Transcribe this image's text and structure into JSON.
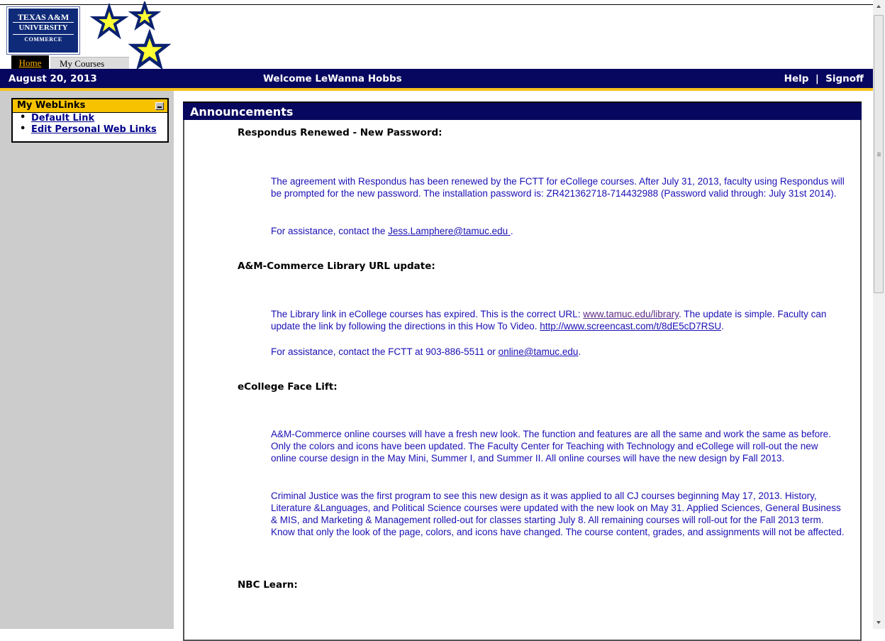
{
  "header": {
    "logo": {
      "line1": "TEXAS A&M",
      "line2": "UNIVERSITY",
      "line3": "COMMERCE"
    },
    "tabs": [
      {
        "label": "Home"
      },
      {
        "label": "My Courses"
      }
    ],
    "date": "August 20, 2013",
    "welcome": "Welcome LeWanna Hobbs",
    "help_label": "Help",
    "separator": "|",
    "signoff_label": "Signoff"
  },
  "sidebar": {
    "title": "My WebLinks",
    "links": [
      {
        "label": "Default Link"
      },
      {
        "label": "Edit Personal Web Links"
      }
    ]
  },
  "announcements": {
    "title": "Announcements",
    "items": [
      {
        "title": "Respondus Renewed - New Password:",
        "p1": "The agreement with Respondus has been renewed by the FCTT for eCollege courses. After July 31, 2013, faculty using Respondus will be prompted for the new password. The installation password is: ZR421362718-714432988 (Password valid through: July 31st 2014).",
        "p2_pre": "For assistance, contact the ",
        "p2_link": "Jess.Lamphere@tamuc.edu ",
        "p2_post": "."
      },
      {
        "title": "A&M-Commerce Library URL update:",
        "p1_pre": "The Library link in eCollege courses has expired. This is the correct URL: ",
        "p1_link1": "www.tamuc.edu/library",
        "p1_mid": ". The update is simple. Faculty can update the link by following the directions in this How To Video.  ",
        "p1_link2": "http://www.screencast.com/t/8dE5cD7RSU",
        "p1_post": ".",
        "p2_pre": "For assistance, contact the FCTT at 903-886-5511 or ",
        "p2_link": "online@tamuc.edu",
        "p2_post": "."
      },
      {
        "title": "eCollege Face Lift:",
        "p1": "A&M-Commerce online courses will have a fresh new look. The function and features are all the same and work the same as before. Only the colors and icons have been updated. The Faculty Center for Teaching with Technology and eCollege will roll-out the new online course design in the May Mini, Summer I, and Summer II. All online courses will have the new design by Fall 2013.",
        "p2": "Criminal Justice was the first program to see this new design as it was applied to all CJ courses beginning May 17, 2013. History, Literature &Languages, and Political Science courses were updated with the new look on May 31. Applied Sciences, General Business & MIS, and Marketing & Management rolled-out for classes starting July 8. All remaining courses will roll-out for the Fall 2013 term. Know that only the look of the page, colors, and icons have changed. The course content, grades, and assignments will not be affected."
      },
      {
        "title": "NBC Learn:"
      }
    ]
  },
  "colors": {
    "navy": "#07075f",
    "gold": "#f5c11b",
    "announcement_text": "#1a10b4",
    "sidebar_bg": "#cccccc"
  },
  "icons": [
    "star-icon",
    "minimize-icon",
    "scroll-up-icon",
    "scroll-down-icon"
  ]
}
